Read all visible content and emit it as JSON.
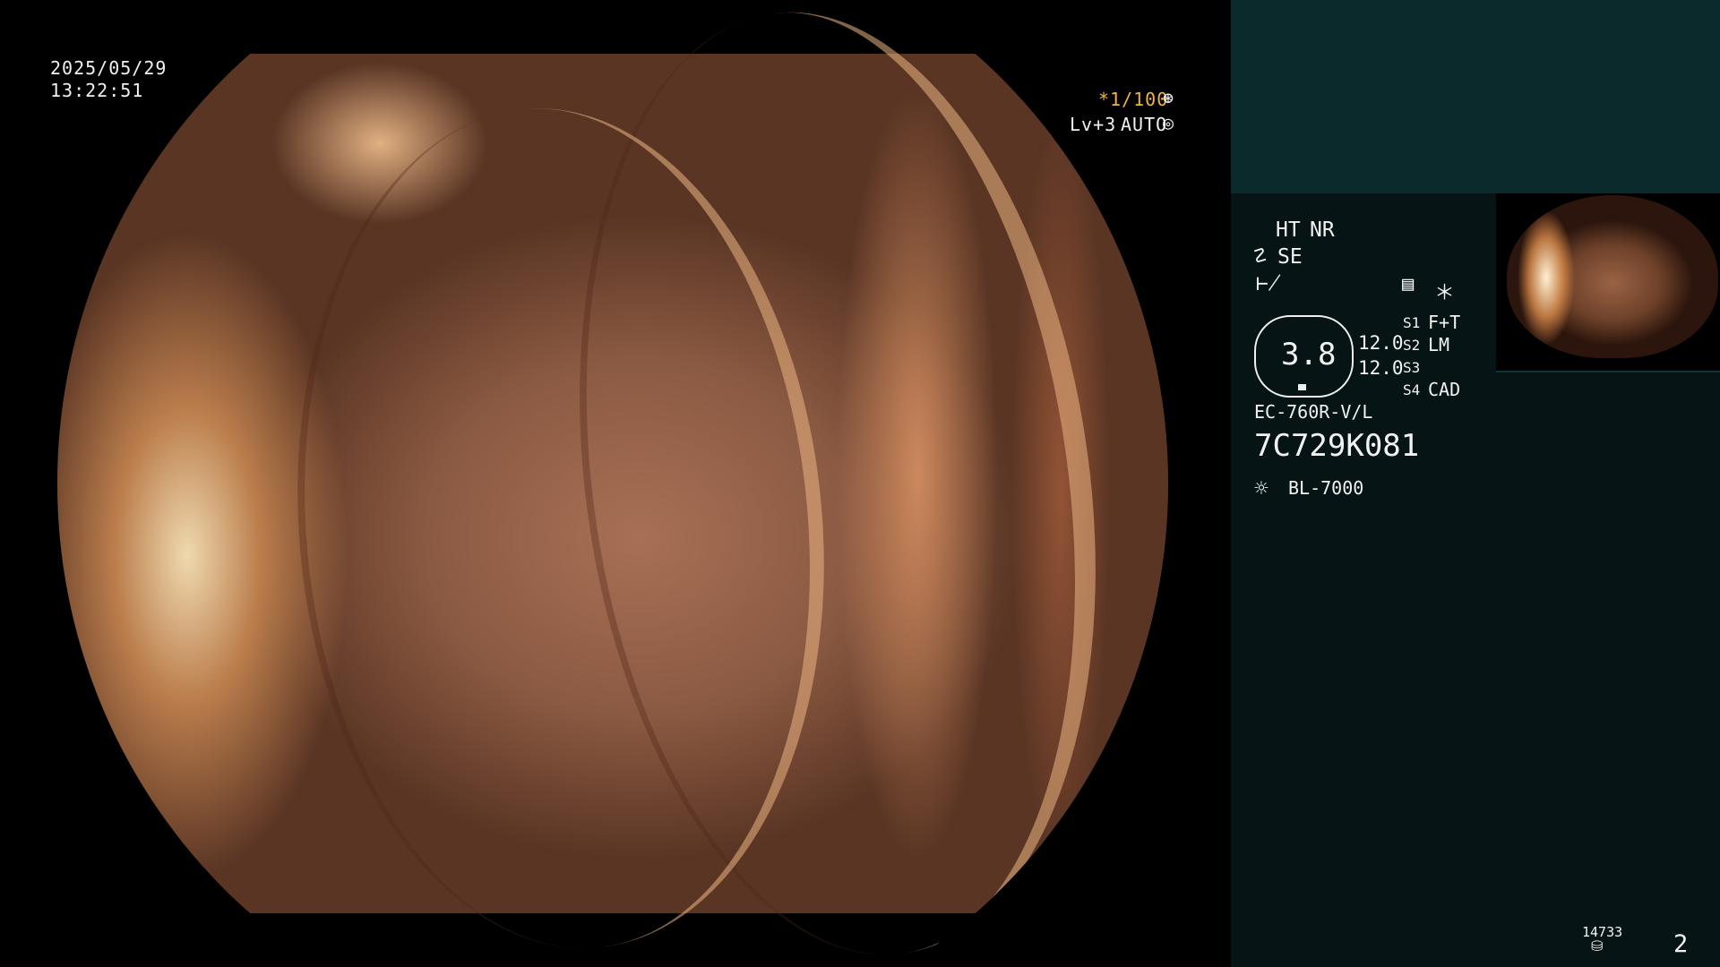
{
  "video": {
    "date": "2025/05/29",
    "time": "13:22:51",
    "shutter": "*1/100",
    "level": "Lv+3",
    "mode": "AUTO"
  },
  "panel": {
    "ht": "HT",
    "nr": "NR",
    "se": "SE",
    "zoom": "3.8",
    "left_value": "12.0",
    "right_value": "12.0",
    "s1_label": "S1",
    "s1_value": "F+T",
    "s2_label": "S2",
    "s2_value": "LM",
    "s3_label": "S3",
    "s3_value": "",
    "s4_label": "S4",
    "s4_value": "CAD",
    "model": "EC-760R-V/L",
    "serial": "7C729K081",
    "light_source": "BL-7000",
    "record_count": "14733",
    "page_number": "2"
  },
  "icons": {
    "camera": "camera-icon",
    "settings": "settings-icon",
    "sun": "sun-icon",
    "disk": "disk-icon"
  },
  "colors": {
    "accent_yellow": "#f0b33e",
    "panel_bg": "#071416",
    "top_panel_bg": "#0a2a2b"
  }
}
